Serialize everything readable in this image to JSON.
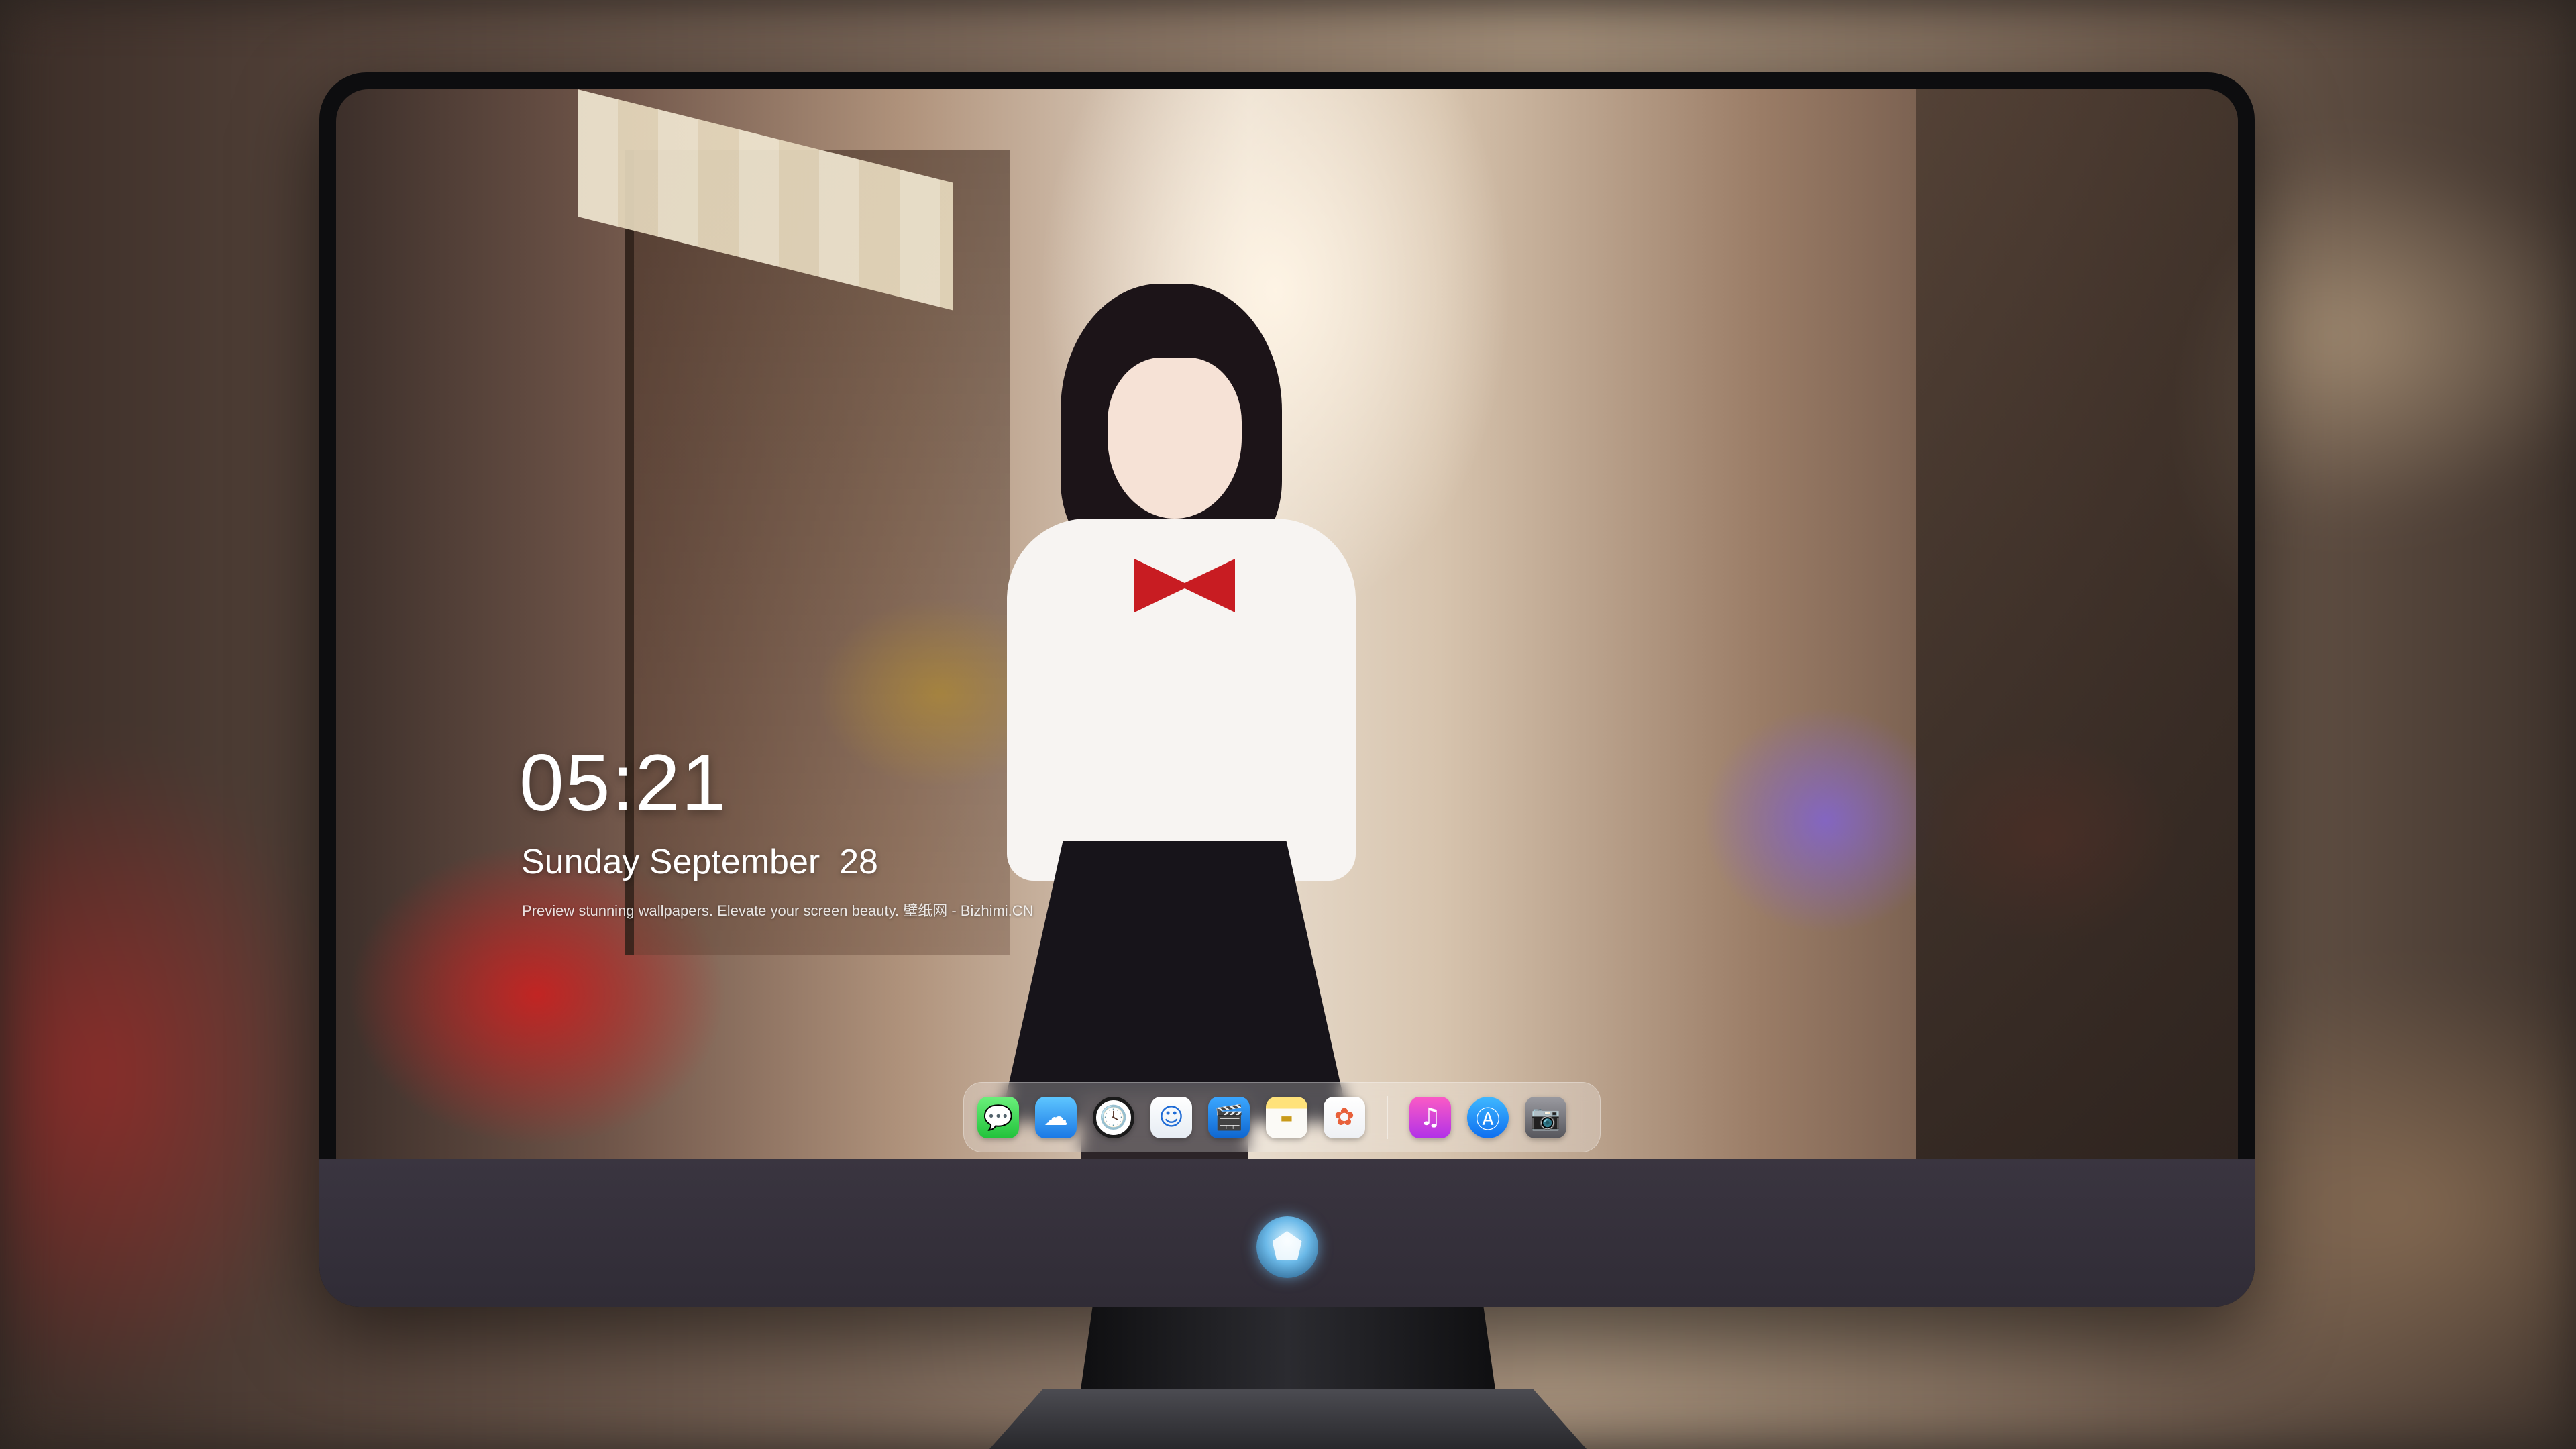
{
  "lock_screen": {
    "time": "05:21",
    "date": "Sunday September  28",
    "tagline": "Preview stunning wallpapers. Elevate your screen beauty. 壁纸网 - Bizhimi.CN"
  },
  "dock": {
    "apps": [
      {
        "name": "messages",
        "icon": "speech-bubble",
        "glyph": "💬"
      },
      {
        "name": "weather",
        "icon": "cloud-sun",
        "glyph": "☁"
      },
      {
        "name": "clock",
        "icon": "clock",
        "glyph": "🕓"
      },
      {
        "name": "finder",
        "icon": "face",
        "glyph": "☺"
      },
      {
        "name": "video-editor",
        "icon": "clapperboard",
        "glyph": "🎬"
      },
      {
        "name": "notes",
        "icon": "notepad",
        "glyph": "▬"
      },
      {
        "name": "photos",
        "icon": "photos",
        "glyph": "✿"
      },
      {
        "name": "music",
        "icon": "music-note",
        "glyph": "♫"
      },
      {
        "name": "app-store",
        "icon": "app-store",
        "glyph": "Ⓐ"
      },
      {
        "name": "camera",
        "icon": "camera",
        "glyph": "📷"
      }
    ]
  },
  "colors": {
    "monitor_bezel": "#0d0d0f",
    "monitor_chin": "#36313c",
    "text": "#ffffff"
  }
}
